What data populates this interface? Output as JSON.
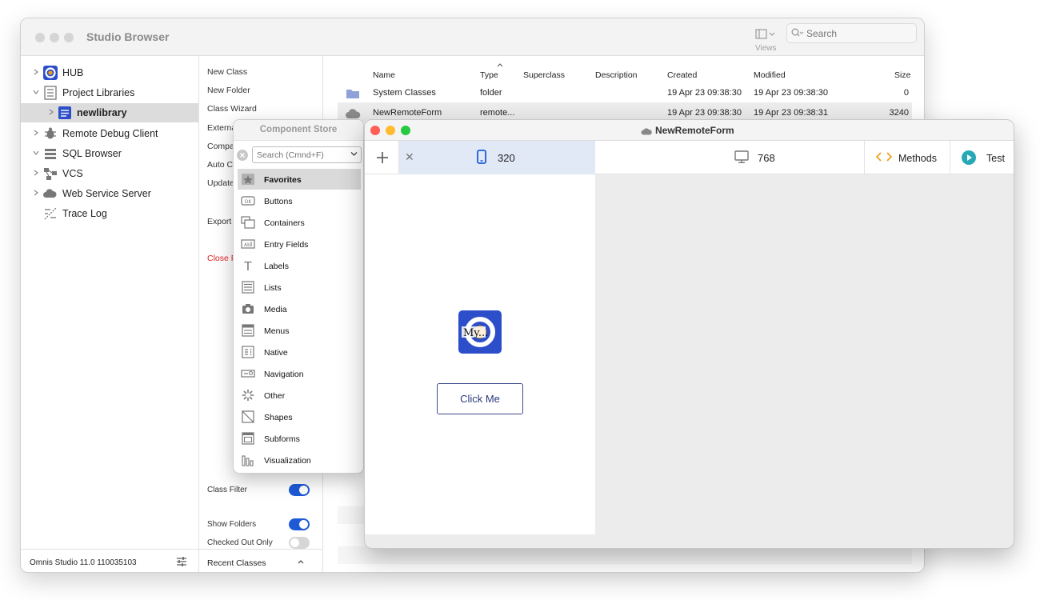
{
  "browser": {
    "title": "Studio Browser",
    "views_label": "Views",
    "search_placeholder": "Search",
    "tree": [
      {
        "label": "HUB"
      },
      {
        "label": "Project Libraries"
      },
      {
        "label": "newlibrary"
      },
      {
        "label": "Remote Debug Client"
      },
      {
        "label": "SQL Browser"
      },
      {
        "label": "VCS"
      },
      {
        "label": "Web Service Server"
      },
      {
        "label": "Trace Log"
      }
    ],
    "version": "Omnis Studio 11.0 110035103",
    "actions": [
      "New Class",
      "New Folder",
      "Class Wizard",
      "Externa",
      "Compa",
      "Auto Cl",
      "Update",
      "Export",
      "Close P"
    ],
    "toggles": [
      {
        "label": "Class Filter",
        "on": true
      },
      {
        "label": "Show Folders",
        "on": true
      },
      {
        "label": "Checked Out Only",
        "on": false
      }
    ],
    "recent_classes": "Recent Classes",
    "columns": [
      "Name",
      "Type",
      "Superclass",
      "Description",
      "Created",
      "Modified",
      "Size"
    ],
    "rows": [
      {
        "name": "System Classes",
        "type": "folder",
        "superclass": "",
        "description": "",
        "created": "19 Apr 23  09:38:30",
        "modified": "19 Apr 23  09:38:30",
        "size": "0"
      },
      {
        "name": "NewRemoteForm",
        "type": "remote...",
        "superclass": "",
        "description": "",
        "created": "19 Apr 23  09:38:30",
        "modified": "19 Apr 23  09:38:31",
        "size": "3240"
      }
    ]
  },
  "component_store": {
    "title": "Component Store",
    "search_placeholder": "Search (Cmnd+F)",
    "items": [
      {
        "label": "Favorites",
        "icon": "star-icon"
      },
      {
        "label": "Buttons",
        "icon": "ok-button-icon"
      },
      {
        "label": "Containers",
        "icon": "containers-icon"
      },
      {
        "label": "Entry Fields",
        "icon": "entry-field-icon"
      },
      {
        "label": "Labels",
        "icon": "text-label-icon"
      },
      {
        "label": "Lists",
        "icon": "list-icon"
      },
      {
        "label": "Media",
        "icon": "camera-icon"
      },
      {
        "label": "Menus",
        "icon": "menu-icon"
      },
      {
        "label": "Native",
        "icon": "native-icon"
      },
      {
        "label": "Navigation",
        "icon": "navigation-icon"
      },
      {
        "label": "Other",
        "icon": "spinner-icon"
      },
      {
        "label": "Shapes",
        "icon": "shapes-icon"
      },
      {
        "label": "Subforms",
        "icon": "subform-icon"
      },
      {
        "label": "Visualization",
        "icon": "chart-icon"
      }
    ]
  },
  "remote_form": {
    "title": "NewRemoteForm",
    "mobile_width": "320",
    "desktop_width": "768",
    "methods_label": "Methods",
    "test_label": "Test",
    "logo_text": "My...",
    "button_label": "Click Me"
  },
  "colors": {
    "accent": "#1e5ad6",
    "danger": "#e02020",
    "hub_blue": "#2c4fc9",
    "hub_orange": "#f29a1a",
    "test_teal": "#27a9b5",
    "methods_orange": "#f0a020",
    "mobile_tab_bg": "#e1e9f7"
  }
}
